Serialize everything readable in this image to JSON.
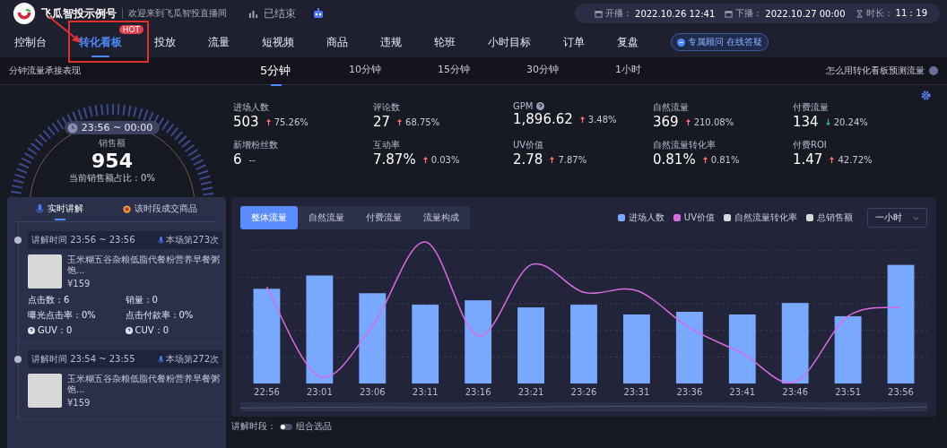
{
  "header": {
    "account": "飞瓜智投示例号",
    "welcome": "欢迎来到飞瓜智投直播间",
    "status": "已结束",
    "start_label": "开播：",
    "start": "2022.10.26 12:41",
    "end_label": "下播：",
    "end": "2022.10.27 00:00",
    "duration_label": "时长：",
    "duration": "11：19"
  },
  "nav": [
    {
      "label": "控制台",
      "selected": false
    },
    {
      "label": "转化看板",
      "selected": true,
      "badge": "HOT"
    },
    {
      "label": "投放",
      "selected": false
    },
    {
      "label": "流量",
      "selected": false
    },
    {
      "label": "短视频",
      "selected": false
    },
    {
      "label": "商品",
      "selected": false
    },
    {
      "label": "违规",
      "selected": false
    },
    {
      "label": "轮班",
      "selected": false
    },
    {
      "label": "小时目标",
      "selected": false
    },
    {
      "label": "订单",
      "selected": false
    },
    {
      "label": "复盘",
      "selected": false
    }
  ],
  "advisor": "专属顾问 在线答疑",
  "subbar": {
    "title": "分钟流量承接表现",
    "intervals": [
      {
        "label": "5分钟",
        "selected": true
      },
      {
        "label": "10分钟",
        "selected": false
      },
      {
        "label": "15分钟",
        "selected": false
      },
      {
        "label": "30分钟",
        "selected": false
      },
      {
        "label": "1小时",
        "selected": false
      }
    ],
    "help_link": "怎么用转化看板预测流量"
  },
  "gauge": {
    "range": "23:56 ~ 00:00",
    "label": "销售额",
    "value": "954",
    "share": "当前销售额占比：0%"
  },
  "metrics": [
    {
      "label": "进场人数",
      "value": "503",
      "change": "75.26%",
      "rising": true,
      "help": false
    },
    {
      "label": "评论数",
      "value": "27",
      "change": "68.75%",
      "rising": true,
      "help": false
    },
    {
      "label": "GPM",
      "value": "1,896.62",
      "change": "3.48%",
      "rising": true,
      "help": true
    },
    {
      "label": "自然流量",
      "value": "369",
      "change": "210.08%",
      "rising": true,
      "help": false
    },
    {
      "label": "付费流量",
      "value": "134",
      "change": "20.24%",
      "rising": false,
      "help": false
    },
    {
      "label": "新增粉丝数",
      "value": "6",
      "change": "--",
      "help": false
    },
    {
      "label": "互动率",
      "value": "7.87%",
      "change": "0.03%",
      "rising": true,
      "help": false
    },
    {
      "label": "UV价值",
      "value": "2.78",
      "change": "7.87%",
      "rising": true,
      "help": false
    },
    {
      "label": "自然流量转化率",
      "value": "0.81%",
      "change": "0.81%",
      "rising": true,
      "help": false
    },
    {
      "label": "付费ROI",
      "value": "1.47",
      "change": "42.72%",
      "rising": true,
      "help": false
    }
  ],
  "left_panel": {
    "tabs": [
      {
        "label": "实时讲解",
        "selected": true
      },
      {
        "label": "该时段成交商品",
        "selected": false
      }
    ],
    "sessions": [
      {
        "time": "讲解时间 23:56 ~ 23:56",
        "count": "本场第273次",
        "title": "玉米糊五谷杂粮低脂代餐粉营养早餐粥饱...",
        "price": "¥159",
        "stats": [
          {
            "text": "点击数：6",
            "help": false
          },
          {
            "text": "销量：0",
            "help": false
          },
          {
            "text": "曝光点击率：0%",
            "help": false
          },
          {
            "text": "点击付款率：0%",
            "help": false
          },
          {
            "text": "GUV：0",
            "help": true
          },
          {
            "text": "CUV：0",
            "help": true
          }
        ]
      },
      {
        "time": "讲解时间 23:54 ~ 23:55",
        "count": "本场第272次",
        "title": "玉米糊五谷杂粮低脂代餐粉营养早餐粥饱...",
        "price": "¥159"
      }
    ]
  },
  "chart_panel": {
    "tabs": [
      {
        "label": "整体流量",
        "selected": true
      },
      {
        "label": "自然流量",
        "selected": false
      },
      {
        "label": "付费流量",
        "selected": false
      },
      {
        "label": "流量构成",
        "selected": false
      }
    ],
    "legend": [
      {
        "label": "进场人数",
        "color": "#78a8ff"
      },
      {
        "label": "UV价值",
        "color": "#d66ce0"
      },
      {
        "label": "自然流量转化率",
        "color": "#d9d9d9"
      },
      {
        "label": "总销售额",
        "color": "#d9d9d9"
      }
    ],
    "range": "一小时",
    "x_labels": [
      "22:56",
      "23:01",
      "23:06",
      "23:11",
      "23:16",
      "23:21",
      "23:26",
      "23:31",
      "23:36",
      "23:41",
      "23:46",
      "23:51",
      "23:56"
    ]
  },
  "footer": {
    "label": "讲解时段：",
    "toggle_on": false,
    "option": "组合选品"
  }
}
